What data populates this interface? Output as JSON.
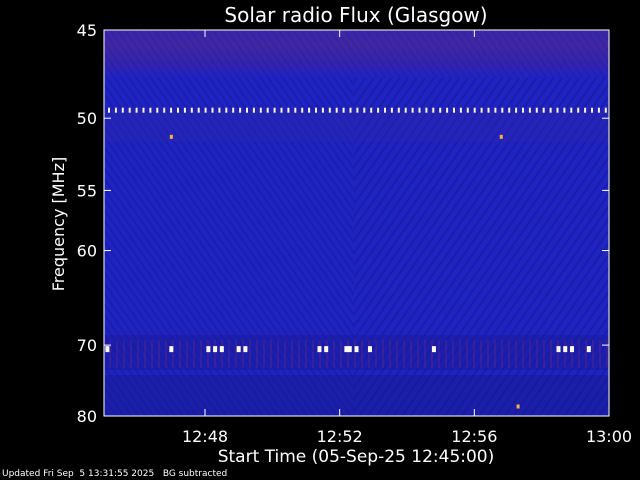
{
  "chart_data": {
    "type": "heatmap",
    "title": "Solar radio Flux (Glasgow)",
    "xlabel": "Start Time (05-Sep-25 12:45:00)",
    "ylabel": "Frequency [MHz]",
    "x_range_minutes": [
      0,
      15
    ],
    "x_ticks": [
      {
        "label": "12:48",
        "minutes": 3
      },
      {
        "label": "12:52",
        "minutes": 7
      },
      {
        "label": "12:56",
        "minutes": 11
      },
      {
        "label": "13:00",
        "minutes": 15
      }
    ],
    "y_range_mhz": [
      45,
      80
    ],
    "y_scale": "reciprocal",
    "y_ticks": [
      {
        "label": "45",
        "mhz": 45
      },
      {
        "label": "50",
        "mhz": 50
      },
      {
        "label": "55",
        "mhz": 55
      },
      {
        "label": "60",
        "mhz": 60
      },
      {
        "label": "70",
        "mhz": 70
      },
      {
        "label": "80",
        "mhz": 80
      }
    ],
    "colormap": [
      "#0a0a5e",
      "#1a1ab8",
      "#2b2bd8",
      "#5b2a8a",
      "#c8502a",
      "#ffd27a",
      "#ffffff"
    ],
    "background_color": "#1e22c0",
    "features": {
      "rfi_line_mhz": 49.5,
      "rfi_line_dashed": true,
      "rfi_burst_line_mhz": 70.5,
      "rfi_burst_minutes": [
        0.1,
        2.0,
        3.1,
        3.3,
        3.5,
        4.0,
        4.2,
        6.4,
        6.6,
        7.2,
        7.3,
        7.5,
        7.9,
        9.8,
        13.5,
        13.7,
        13.9,
        14.4
      ],
      "hot_spots": [
        {
          "minute": 2.0,
          "mhz": 51.2
        },
        {
          "minute": 11.8,
          "mhz": 51.2
        },
        {
          "minute": 12.3,
          "mhz": 78.5
        }
      ]
    }
  },
  "footer": {
    "updated": "Updated Fri Sep  5 13:31:55 2025",
    "note": "BG subtracted"
  }
}
